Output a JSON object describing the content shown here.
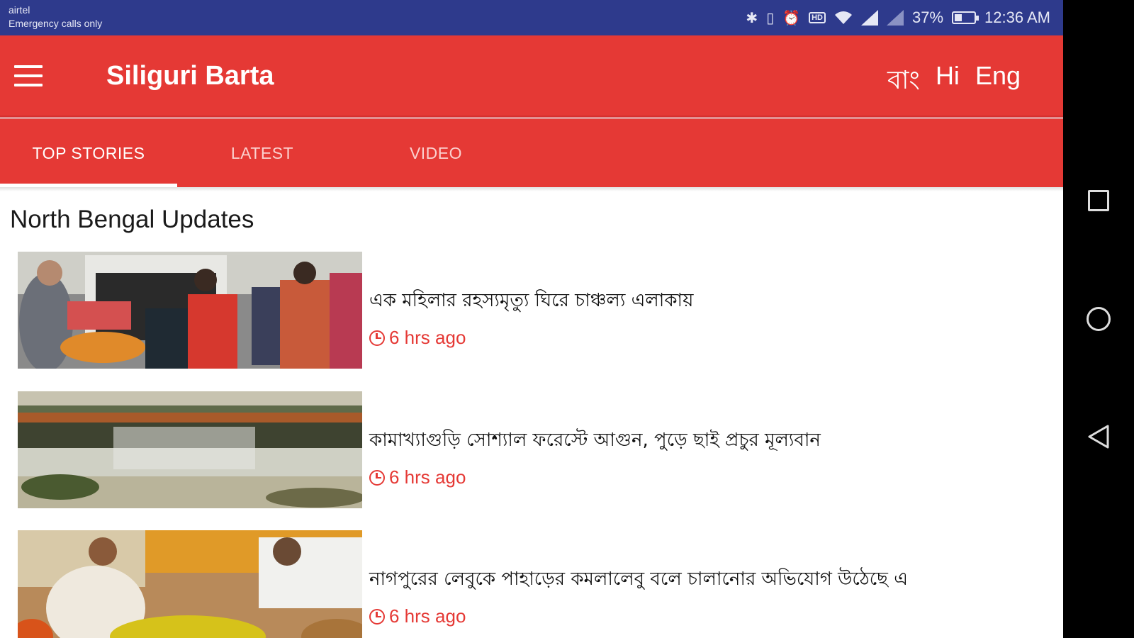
{
  "status_bar": {
    "carrier": "airtel",
    "emergency": "Emergency calls only",
    "battery_percent": "37%",
    "battery_level": 0.37,
    "time": "12:36 AM",
    "hd_label": "HD",
    "icons": [
      "bluetooth-icon",
      "vibrate-icon",
      "alarm-icon",
      "hd-icon",
      "wifi-icon",
      "signal-icon",
      "signal-icon",
      "battery-icon"
    ]
  },
  "app_bar": {
    "title": "Siliguri Barta",
    "menu_icon": "hamburger-menu-icon",
    "languages": [
      "বাং",
      "Hi",
      "Eng"
    ]
  },
  "tabs": [
    {
      "label": "TOP STORIES",
      "active": true
    },
    {
      "label": "LATEST",
      "active": false
    },
    {
      "label": "VIDEO",
      "active": false
    }
  ],
  "section": {
    "title": "North Bengal Updates"
  },
  "stories": [
    {
      "headline": "এক মহিলার রহস্যমৃত্যু ঘিরে চাঞ্চল্য এলাকায়",
      "time": "6 hrs ago"
    },
    {
      "headline": "কামাখ্যাগুড়ি সোশ্যাল ফরেস্টে আগুন, পুড়ে ছাই প্রচুর মূল্যবান",
      "time": "6 hrs ago"
    },
    {
      "headline": "নাগপুরের লেবুকে পাহাড়ের কমলালেবু বলে চালানোর অভিযোগ উঠেছে এ",
      "time": "6 hrs ago"
    }
  ],
  "colors": {
    "primary": "#e53935",
    "status_bar": "#2e3a8c",
    "time_text": "#e53935"
  },
  "nav_bar": {
    "icons": [
      "recent-apps-icon",
      "home-icon",
      "back-icon"
    ]
  }
}
